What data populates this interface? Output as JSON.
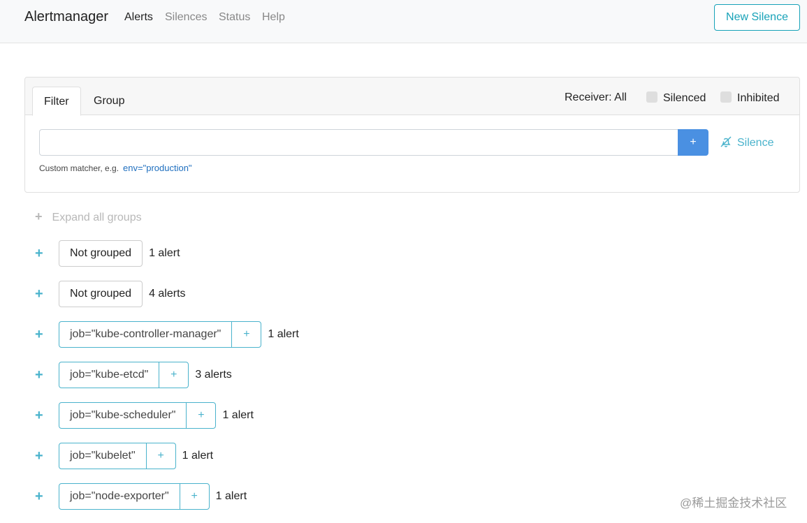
{
  "navbar": {
    "brand": "Alertmanager",
    "links": [
      "Alerts",
      "Silences",
      "Status",
      "Help"
    ],
    "new_silence_label": "New Silence"
  },
  "filter_panel": {
    "tabs": [
      "Filter",
      "Group"
    ],
    "receiver_label": "Receiver: All",
    "silenced_label": "Silenced",
    "inhibited_label": "Inhibited",
    "input_value": "",
    "add_button_label": "+",
    "silence_link_label": "Silence",
    "hint_text": "Custom matcher, e.g.",
    "hint_example": "env=\"production\""
  },
  "expand_all": {
    "plus": "+",
    "label": "Expand all groups"
  },
  "groups": [
    {
      "label": "Not grouped",
      "count": "1 alert",
      "plain": true
    },
    {
      "label": "Not grouped",
      "count": "4 alerts",
      "plain": true
    },
    {
      "label": "job=\"kube-controller-manager\"",
      "count": "1 alert",
      "add": "+"
    },
    {
      "label": "job=\"kube-etcd\"",
      "count": "3 alerts",
      "add": "+"
    },
    {
      "label": "job=\"kube-scheduler\"",
      "count": "1 alert",
      "add": "+"
    },
    {
      "label": "job=\"kubelet\"",
      "count": "1 alert",
      "add": "+"
    },
    {
      "label": "job=\"node-exporter\"",
      "count": "1 alert",
      "add": "+"
    }
  ],
  "row_plus": "+",
  "watermark": "@稀土掘金技术社区",
  "colors": {
    "accent": "#17a2b8",
    "primary": "#4a90e2",
    "link": "#4ab3cc"
  },
  "icons": {
    "silence": "bell-slash-icon"
  }
}
